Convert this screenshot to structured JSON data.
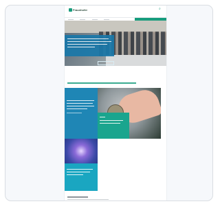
{
  "site": {
    "logo_text": "Fraunhofer"
  },
  "colors": {
    "accent": "#179c7d",
    "blue": "#1a78a9",
    "cyan": "#1aa6c1"
  },
  "icons": {
    "search": "search-icon"
  }
}
